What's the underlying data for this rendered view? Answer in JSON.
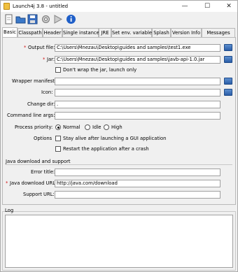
{
  "window": {
    "title": "Launch4j 3.8 - untitled",
    "minimize": "—",
    "maximize": "☐",
    "close": "✕"
  },
  "toolbar": {
    "icons": [
      "new-icon",
      "open-icon",
      "save-icon",
      "settings-icon",
      "run-icon",
      "info-icon"
    ]
  },
  "tabs": [
    "Basic",
    "Classpath",
    "Header",
    "Single instance",
    "JRE",
    "Set env. variables",
    "Splash",
    "Version Info",
    "Messages"
  ],
  "basic": {
    "output_file_label": "Output file:",
    "output_file_value": "C:\\Users\\Mnezau\\Desktop\\guides and samples\\test1.exe",
    "jar_label": "Jar:",
    "jar_value": "C:\\Users\\Mnezau\\Desktop\\guides and samples\\javb-api-1.0.jar",
    "dont_wrap_label": "Don't wrap the jar, launch only",
    "wrapper_manifest_label": "Wrapper manifest:",
    "icon_label": "Icon:",
    "change_dir_label": "Change dir:",
    "change_dir_value": ".",
    "cmd_args_label": "Command line args:",
    "priority_label": "Process priority:",
    "priority_options": [
      "Normal",
      "Idle",
      "High"
    ],
    "priority_selected": "Normal",
    "options_label": "Options",
    "stay_alive_label": "Stay alive after launching a GUI application",
    "restart_label": "Restart the application after a crash"
  },
  "java_download": {
    "section_title": "Java download and support",
    "error_title_label": "Error title:",
    "download_url_label": "Java download URL:",
    "download_url_value": "http://java.com/download",
    "support_url_label": "Support URL:"
  },
  "log": {
    "title": "Log"
  },
  "colors": {
    "required": "#d01010",
    "browse": "#2a5da8"
  }
}
